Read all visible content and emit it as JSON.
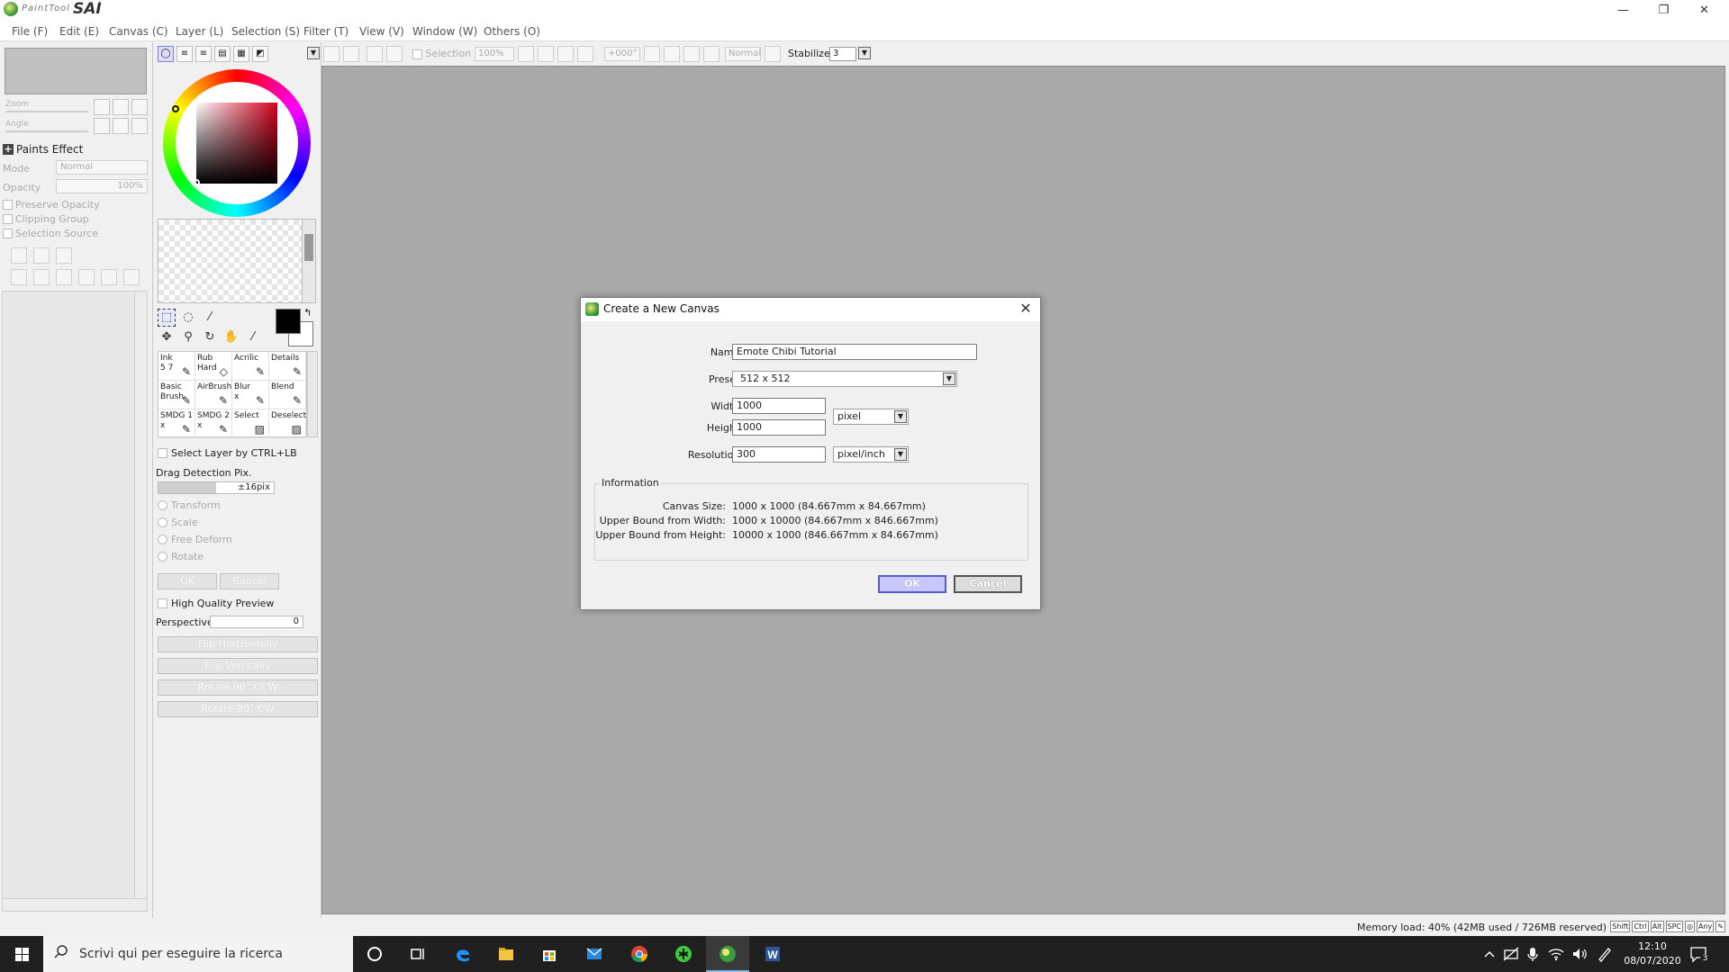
{
  "window": {
    "title_small": "PaintTool",
    "title_big": "SAI",
    "minimize": "—",
    "restore": "❐",
    "close": "✕"
  },
  "menu": [
    "File (F)",
    "Edit (E)",
    "Canvas (C)",
    "Layer (L)",
    "Selection (S)",
    "Filter (T)",
    "View (V)",
    "Window (W)",
    "Others (O)"
  ],
  "left_panel": {
    "zoom_label": "Zoom",
    "angle_label": "Angle",
    "paints_effect": "Paints Effect",
    "mode_label": "Mode",
    "mode_value": "Normal",
    "opacity_label": "Opacity",
    "opacity_value": "100%",
    "preserve_opacity": "Preserve Opacity",
    "clipping_group": "Clipping Group",
    "selection_source": "Selection Source"
  },
  "tool_panel": {
    "brushes": [
      {
        "line1": "Ink",
        "line2": "5 7"
      },
      {
        "line1": "Rub",
        "line2": "Hard"
      },
      {
        "line1": "Acrilic",
        "line2": ""
      },
      {
        "line1": "Details",
        "line2": ""
      },
      {
        "line1": "Basic",
        "line2": "Brush"
      },
      {
        "line1": "AirBrush",
        "line2": ""
      },
      {
        "line1": "Blur",
        "line2": "x"
      },
      {
        "line1": "Blend",
        "line2": ""
      },
      {
        "line1": "SMDG 1",
        "line2": "x"
      },
      {
        "line1": "SMDG 2",
        "line2": "x"
      },
      {
        "line1": "Select",
        "line2": ""
      },
      {
        "line1": "Deselect",
        "line2": ""
      }
    ],
    "select_layer_ctrl": "Select Layer by CTRL+LB",
    "drag_detection": "Drag Detection Pix.",
    "drag_value": "±16pix",
    "drag_fraction": 0.5,
    "transform": "Transform",
    "scale": "Scale",
    "free_deform": "Free Deform",
    "rotate": "Rotate",
    "ok": "OK",
    "cancel": "Cancel",
    "high_quality_preview": "High Quality Preview",
    "perspective_label": "Perspective",
    "perspective_value": "0",
    "flip_h": "Flip Horizontally",
    "flip_v": "Flip Vertically",
    "rotate_ccw": "Rotate 90° CCW",
    "rotate_cw": "Rotate 90° CW",
    "fg_color": "#000000",
    "bg_color": "#ffffff"
  },
  "toolbar": {
    "selection_label": "Selection",
    "zoom_value": "100%",
    "angle_value": "+000°",
    "blend_value": "Normal",
    "stabilizer_label": "Stabilizer",
    "stabilizer_value": "3"
  },
  "status": {
    "memory": "Memory load: 40% (42MB used / 726MB reserved)",
    "keys": [
      "Shift",
      "Ctrl",
      "Alt",
      "SPC",
      "◎",
      "Any",
      "✎"
    ]
  },
  "dialog": {
    "title": "Create a New Canvas",
    "name_label": "Name:",
    "name_value": "Emote Chibi Tutorial",
    "preset_label": "Preset:",
    "preset_value": "512 x  512",
    "width_label": "Width:",
    "width_value": "1000",
    "height_label": "Height:",
    "height_value": "1000",
    "unit_value": "pixel",
    "resolution_label": "Resolution:",
    "resolution_value": "300",
    "resolution_unit": "pixel/inch",
    "info_title": "Information",
    "canvas_size_label": "Canvas Size:",
    "canvas_size_value": "1000 x 1000 (84.667mm x 84.667mm)",
    "ub_width_label": "Upper Bound from Width:",
    "ub_width_value": "1000 x 10000 (84.667mm x 846.667mm)",
    "ub_height_label": "Upper Bound from Height:",
    "ub_height_value": "10000 x 1000 (846.667mm x 84.667mm)",
    "ok": "OK",
    "cancel": "Cancel"
  },
  "taskbar": {
    "search_placeholder": "Scrivi qui per eseguire la ricerca",
    "time": "12:10",
    "date": "08/07/2020",
    "notification_count": "3",
    "apps": [
      "cortana-icon",
      "task-view-icon",
      "edge-icon",
      "file-explorer-icon",
      "store-icon",
      "mail-icon",
      "chrome-icon",
      "app-green-icon",
      "paint-tool-sai-icon",
      "word-icon"
    ]
  }
}
